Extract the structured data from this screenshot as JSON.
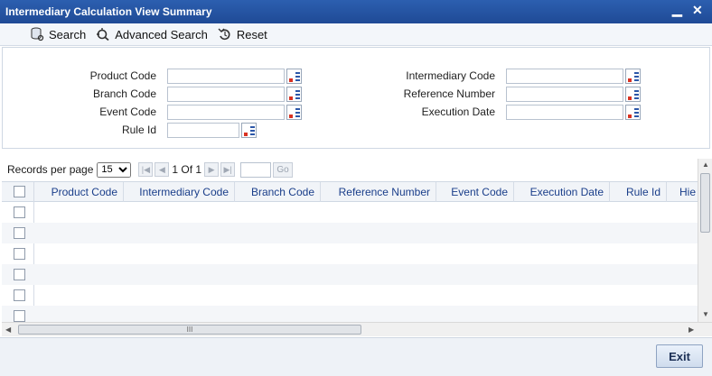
{
  "window": {
    "title": "Intermediary Calculation View Summary",
    "minimize": "▁",
    "close": "✕"
  },
  "toolbar": {
    "search": "Search",
    "advanced_search": "Advanced Search",
    "reset": "Reset"
  },
  "criteria": {
    "product_code": "Product Code",
    "branch_code": "Branch Code",
    "event_code": "Event Code",
    "rule_id": "Rule Id",
    "intermediary_code": "Intermediary Code",
    "reference_number": "Reference Number",
    "execution_date": "Execution Date"
  },
  "pager": {
    "records_label": "Records per page",
    "records_value": "15",
    "page_info": "1 Of 1",
    "go": "Go"
  },
  "grid": {
    "columns": [
      "Product Code",
      "Intermediary Code",
      "Branch Code",
      "Reference Number",
      "Event Code",
      "Execution Date",
      "Rule Id",
      "Hie"
    ]
  },
  "scroll": {
    "h_grip": "III"
  },
  "footer": {
    "exit": "Exit"
  }
}
